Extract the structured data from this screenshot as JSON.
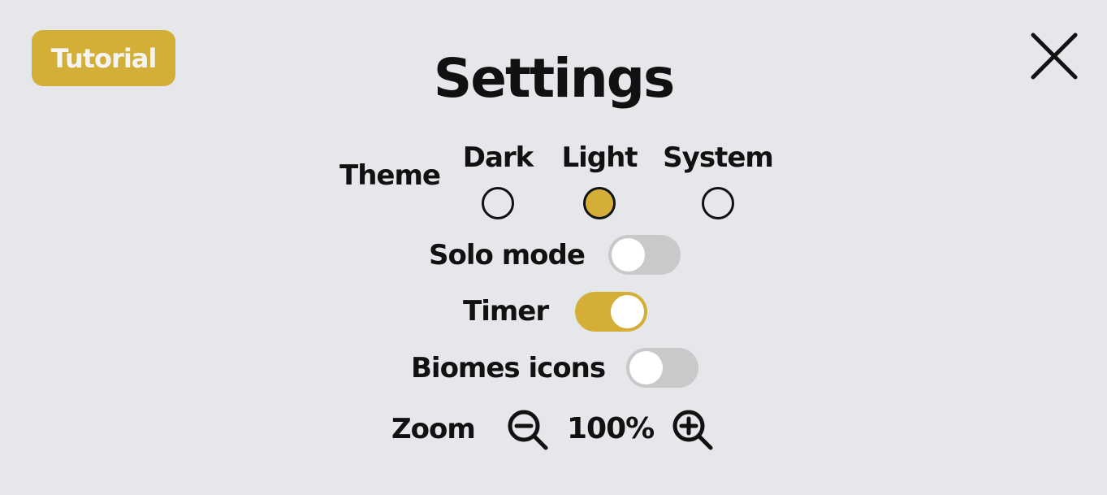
{
  "header": {
    "tutorial_label": "Tutorial",
    "title": "Settings",
    "close_icon": "close-icon"
  },
  "theme": {
    "label": "Theme",
    "options": [
      {
        "label": "Dark",
        "selected": false
      },
      {
        "label": "Light",
        "selected": true
      },
      {
        "label": "System",
        "selected": false
      }
    ]
  },
  "solo_mode": {
    "label": "Solo mode",
    "enabled": false
  },
  "timer": {
    "label": "Timer",
    "enabled": true
  },
  "biomes_icons": {
    "label": "Biomes icons",
    "enabled": false
  },
  "zoom": {
    "label": "Zoom",
    "value": "100%",
    "zoom_out_icon": "zoom-out-icon",
    "zoom_in_icon": "zoom-in-icon"
  },
  "colors": {
    "accent": "#d4af37",
    "background": "#e6e7ea",
    "toggle_off": "#c9c9c9",
    "text": "#111111"
  }
}
